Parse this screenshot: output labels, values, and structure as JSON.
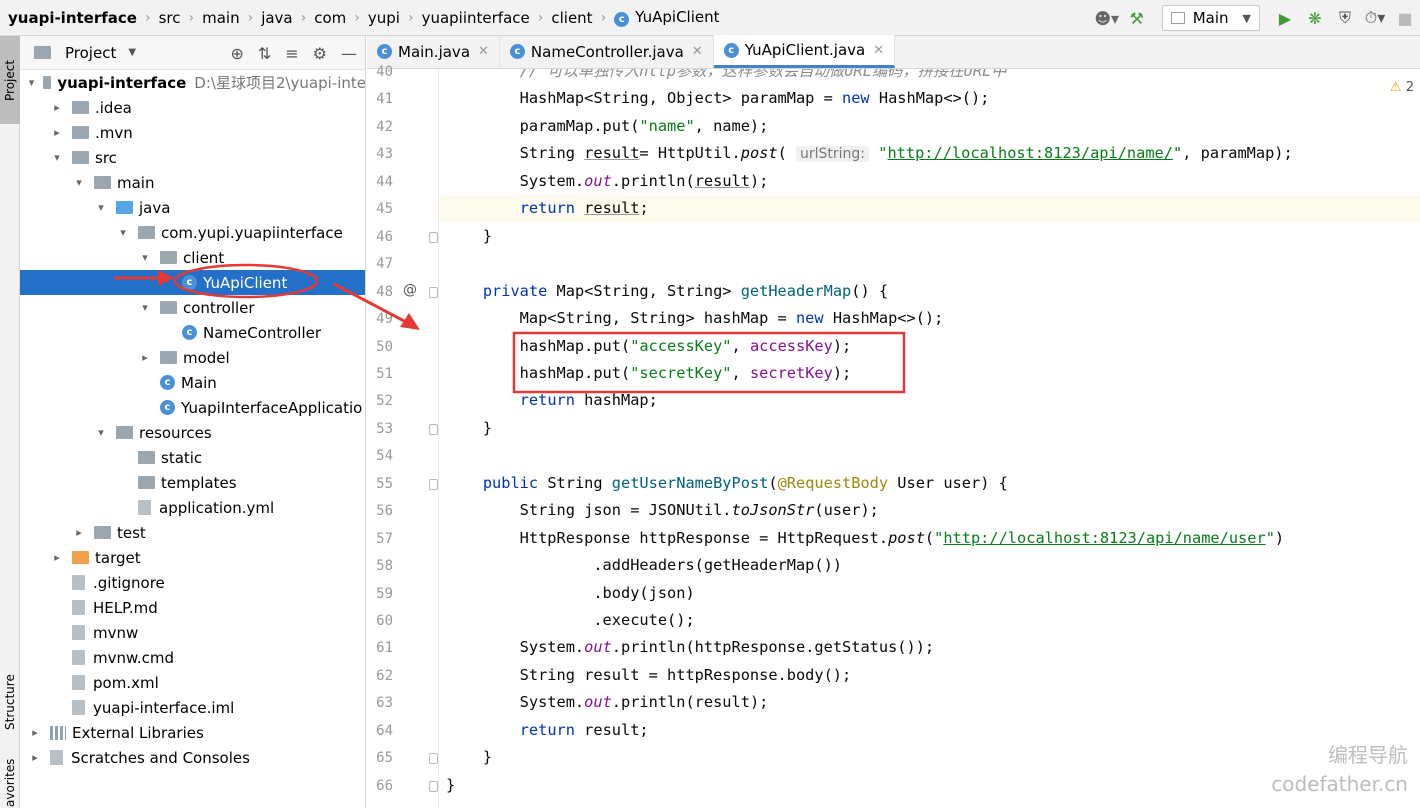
{
  "breadcrumb": [
    "yuapi-interface",
    "src",
    "main",
    "java",
    "com",
    "yupi",
    "yuapiinterface",
    "client",
    "YuApiClient"
  ],
  "toolbar": {
    "run_config": "Main"
  },
  "side_tabs": {
    "project": "Project",
    "structure": "Structure",
    "favorites": "avorites"
  },
  "project_panel": {
    "title": "Project",
    "tree": [
      {
        "label": "yuapi-interface",
        "extra": "D:\\星球项目2\\yuapi-inte",
        "level": 0,
        "arrow": "▾",
        "icon": "folder"
      },
      {
        "label": ".idea",
        "level": 1,
        "arrow": "▸",
        "icon": "folder"
      },
      {
        "label": ".mvn",
        "level": 1,
        "arrow": "▸",
        "icon": "folder"
      },
      {
        "label": "src",
        "level": 1,
        "arrow": "▾",
        "icon": "folder"
      },
      {
        "label": "main",
        "level": 2,
        "arrow": "▾",
        "icon": "folder"
      },
      {
        "label": "java",
        "level": 3,
        "arrow": "▾",
        "icon": "folder-blue"
      },
      {
        "label": "com.yupi.yuapiinterface",
        "level": 4,
        "arrow": "▾",
        "icon": "folder"
      },
      {
        "label": "client",
        "level": 5,
        "arrow": "▾",
        "icon": "folder"
      },
      {
        "label": "YuApiClient",
        "level": 6,
        "arrow": "",
        "icon": "class",
        "selected": true
      },
      {
        "label": "controller",
        "level": 5,
        "arrow": "▾",
        "icon": "folder"
      },
      {
        "label": "NameController",
        "level": 6,
        "arrow": "",
        "icon": "class"
      },
      {
        "label": "model",
        "level": 5,
        "arrow": "▸",
        "icon": "folder"
      },
      {
        "label": "Main",
        "level": 5,
        "arrow": "",
        "icon": "class"
      },
      {
        "label": "YuapiInterfaceApplicatio",
        "level": 5,
        "arrow": "",
        "icon": "class"
      },
      {
        "label": "resources",
        "level": 3,
        "arrow": "▾",
        "icon": "folder-res"
      },
      {
        "label": "static",
        "level": 4,
        "arrow": "",
        "icon": "folder"
      },
      {
        "label": "templates",
        "level": 4,
        "arrow": "",
        "icon": "folder"
      },
      {
        "label": "application.yml",
        "level": 4,
        "arrow": "",
        "icon": "yml"
      },
      {
        "label": "test",
        "level": 2,
        "arrow": "▸",
        "icon": "folder"
      },
      {
        "label": "target",
        "level": 1,
        "arrow": "▸",
        "icon": "folder-orange"
      },
      {
        "label": ".gitignore",
        "level": 1,
        "arrow": "",
        "icon": "file"
      },
      {
        "label": "HELP.md",
        "level": 1,
        "arrow": "",
        "icon": "md"
      },
      {
        "label": "mvnw",
        "level": 1,
        "arrow": "",
        "icon": "file"
      },
      {
        "label": "mvnw.cmd",
        "level": 1,
        "arrow": "",
        "icon": "file"
      },
      {
        "label": "pom.xml",
        "level": 1,
        "arrow": "",
        "icon": "maven"
      },
      {
        "label": "yuapi-interface.iml",
        "level": 1,
        "arrow": "",
        "icon": "file"
      },
      {
        "label": "External Libraries",
        "level": 0,
        "arrow": "▸",
        "icon": "library"
      },
      {
        "label": "Scratches and Consoles",
        "level": 0,
        "arrow": "▸",
        "icon": "scratch"
      }
    ]
  },
  "editor": {
    "tabs": [
      {
        "label": "Main.java",
        "active": false
      },
      {
        "label": "NameController.java",
        "active": false
      },
      {
        "label": "YuApiClient.java",
        "active": true
      }
    ],
    "warning_count": "2",
    "lines": [
      {
        "n": "40",
        "tokens": [
          [
            "        ",
            ""
          ],
          [
            "// 可以单独传入http参数，这样参数会自动做URL编码，拼接在URL中",
            "cmt"
          ]
        ]
      },
      {
        "n": "41",
        "tokens": [
          [
            "        HashMap<String, Object> paramMap = ",
            ""
          ],
          [
            "new",
            "kw"
          ],
          [
            " HashMap<>();",
            ""
          ]
        ]
      },
      {
        "n": "42",
        "tokens": [
          [
            "        paramMap.put(",
            ""
          ],
          [
            "\"name\"",
            "str"
          ],
          [
            ", name);",
            ""
          ]
        ]
      },
      {
        "n": "43",
        "tokens": [
          [
            "        String ",
            ""
          ],
          [
            "result",
            "uline"
          ],
          [
            "= HttpUtil.",
            ""
          ],
          [
            "post",
            "ital"
          ],
          [
            "( ",
            ""
          ],
          [
            "urlString:",
            "hint"
          ],
          [
            " ",
            ""
          ],
          [
            "\"",
            "str"
          ],
          [
            "http://localhost:8123/api/name/",
            "url"
          ],
          [
            "\"",
            "str"
          ],
          [
            ", paramMap);",
            ""
          ]
        ]
      },
      {
        "n": "44",
        "tokens": [
          [
            "        System.",
            ""
          ],
          [
            "out",
            "fld ital"
          ],
          [
            ".println(",
            ""
          ],
          [
            "result",
            "uline"
          ],
          [
            ");",
            ""
          ]
        ]
      },
      {
        "n": "45",
        "tokens": [
          [
            "        ",
            ""
          ],
          [
            "return",
            "kw"
          ],
          [
            " ",
            ""
          ],
          [
            "result",
            "uline"
          ],
          [
            ";",
            ""
          ]
        ],
        "current": true
      },
      {
        "n": "46",
        "tokens": [
          [
            "    }",
            ""
          ]
        ]
      },
      {
        "n": "47",
        "tokens": []
      },
      {
        "n": "48",
        "tokens": [
          [
            "    ",
            ""
          ],
          [
            "private",
            "kw"
          ],
          [
            " Map<String, String> ",
            ""
          ],
          [
            "getHeaderMap",
            "fn"
          ],
          [
            "() {",
            ""
          ]
        ],
        "marker": "@"
      },
      {
        "n": "49",
        "tokens": [
          [
            "        Map<String, String> hashMap = ",
            ""
          ],
          [
            "new",
            "kw"
          ],
          [
            " HashMap<>();",
            ""
          ]
        ]
      },
      {
        "n": "50",
        "tokens": [
          [
            "        hashMap.put(",
            ""
          ],
          [
            "\"accessKey\"",
            "str"
          ],
          [
            ", ",
            ""
          ],
          [
            "accessKey",
            "fld"
          ],
          [
            ");",
            ""
          ]
        ]
      },
      {
        "n": "51",
        "tokens": [
          [
            "        hashMap.put(",
            ""
          ],
          [
            "\"secretKey\"",
            "str"
          ],
          [
            ", ",
            ""
          ],
          [
            "secretKey",
            "fld"
          ],
          [
            ");",
            ""
          ]
        ]
      },
      {
        "n": "52",
        "tokens": [
          [
            "        ",
            ""
          ],
          [
            "return",
            "kw"
          ],
          [
            " hashMap;",
            ""
          ]
        ]
      },
      {
        "n": "53",
        "tokens": [
          [
            "    }",
            ""
          ]
        ]
      },
      {
        "n": "54",
        "tokens": []
      },
      {
        "n": "55",
        "tokens": [
          [
            "    ",
            ""
          ],
          [
            "public",
            "kw"
          ],
          [
            " String ",
            ""
          ],
          [
            "getUserNameByPost",
            "fn"
          ],
          [
            "(",
            ""
          ],
          [
            "@RequestBody",
            "ann"
          ],
          [
            " User user) {",
            ""
          ]
        ]
      },
      {
        "n": "56",
        "tokens": [
          [
            "        String json = JSONUtil.",
            ""
          ],
          [
            "toJsonStr",
            "ital"
          ],
          [
            "(user);",
            ""
          ]
        ]
      },
      {
        "n": "57",
        "tokens": [
          [
            "        HttpResponse httpResponse = HttpRequest.",
            ""
          ],
          [
            "post",
            "ital"
          ],
          [
            "(",
            ""
          ],
          [
            "\"",
            "str"
          ],
          [
            "http://localhost:8123/api/name/user",
            "url"
          ],
          [
            "\"",
            "str"
          ],
          [
            ")",
            ""
          ]
        ]
      },
      {
        "n": "58",
        "tokens": [
          [
            "                .addHeaders(getHeaderMap())",
            ""
          ]
        ]
      },
      {
        "n": "59",
        "tokens": [
          [
            "                .body(json)",
            ""
          ]
        ]
      },
      {
        "n": "60",
        "tokens": [
          [
            "                .execute();",
            ""
          ]
        ]
      },
      {
        "n": "61",
        "tokens": [
          [
            "        System.",
            ""
          ],
          [
            "out",
            "fld ital"
          ],
          [
            ".println(httpResponse.getStatus());",
            ""
          ]
        ]
      },
      {
        "n": "62",
        "tokens": [
          [
            "        String result = httpResponse.body();",
            ""
          ]
        ]
      },
      {
        "n": "63",
        "tokens": [
          [
            "        System.",
            ""
          ],
          [
            "out",
            "fld ital"
          ],
          [
            ".println(result);",
            ""
          ]
        ]
      },
      {
        "n": "64",
        "tokens": [
          [
            "        ",
            ""
          ],
          [
            "return",
            "kw"
          ],
          [
            " result;",
            ""
          ]
        ]
      },
      {
        "n": "65",
        "tokens": [
          [
            "    }",
            ""
          ]
        ]
      },
      {
        "n": "66",
        "tokens": [
          [
            "}",
            ""
          ]
        ]
      }
    ]
  },
  "watermark": {
    "line1": "编程导航",
    "line2": "codefather.cn"
  },
  "colors": {
    "selection": "#2470c8",
    "annotation_red": "#e53935",
    "keyword": "#0033b3",
    "string": "#067d17",
    "field": "#871094"
  }
}
